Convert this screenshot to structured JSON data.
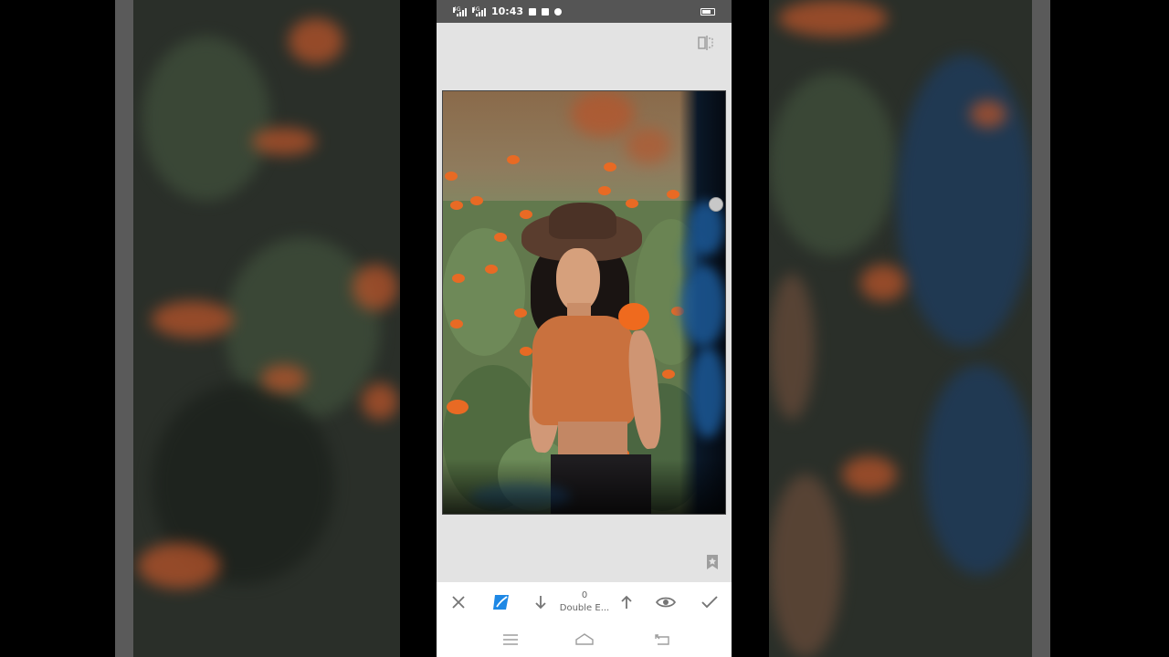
{
  "status_bar": {
    "network_1": "4G",
    "network_2": "4G",
    "time": "10:43"
  },
  "toolbar": {
    "brush_value": "0",
    "brush_label": "Double E..."
  },
  "icons": {
    "compare": "compare-split-icon",
    "cancel": "close-icon",
    "brush": "brush-icon",
    "decrease": "arrow-down-icon",
    "increase": "arrow-up-icon",
    "view_mask": "eye-icon",
    "apply": "checkmark-icon",
    "bookmark": "bookmark-icon",
    "nav_menu": "menu-icon",
    "nav_home": "home-icon",
    "nav_back": "back-icon"
  },
  "colors": {
    "accent": "#1e88e5",
    "icon_gray": "#757575",
    "status_bar_bg": "#555555",
    "canvas_bg": "#e3e3e3"
  }
}
